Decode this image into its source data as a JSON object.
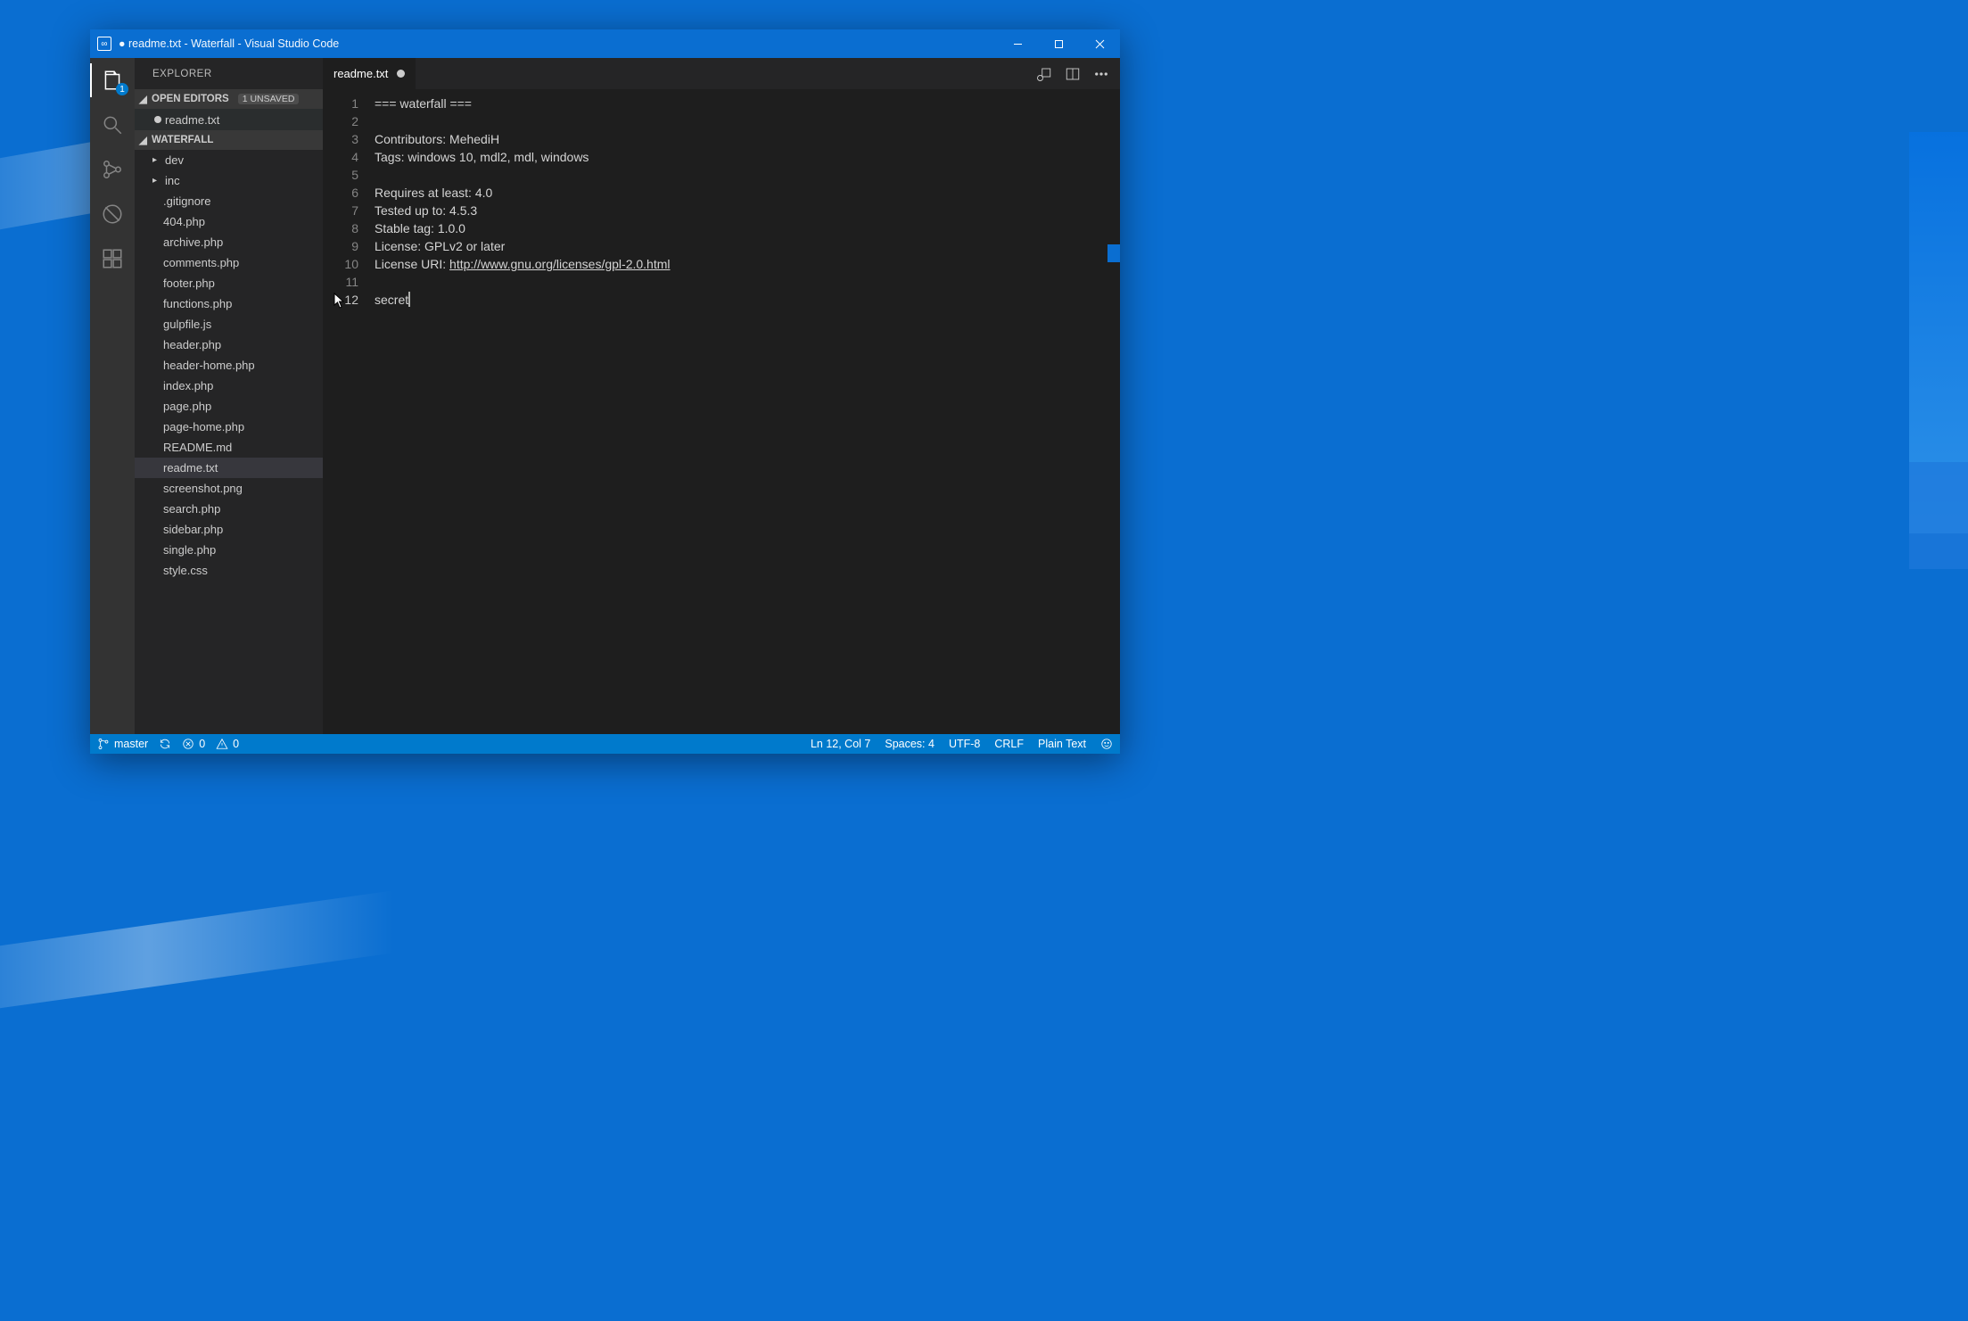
{
  "window": {
    "title": "● readme.txt - Waterfall - Visual Studio Code"
  },
  "activitybar": {
    "explorer_badge": "1"
  },
  "sidebar": {
    "title": "EXPLORER",
    "open_editors_label": "OPEN EDITORS",
    "unsaved_badge": "1 UNSAVED",
    "open_editor_item": "readme.txt",
    "project_label": "WATERFALL",
    "tree": [
      {
        "type": "folder",
        "name": "dev"
      },
      {
        "type": "folder",
        "name": "inc"
      },
      {
        "type": "file",
        "name": ".gitignore"
      },
      {
        "type": "file",
        "name": "404.php"
      },
      {
        "type": "file",
        "name": "archive.php"
      },
      {
        "type": "file",
        "name": "comments.php"
      },
      {
        "type": "file",
        "name": "footer.php"
      },
      {
        "type": "file",
        "name": "functions.php"
      },
      {
        "type": "file",
        "name": "gulpfile.js"
      },
      {
        "type": "file",
        "name": "header.php"
      },
      {
        "type": "file",
        "name": "header-home.php"
      },
      {
        "type": "file",
        "name": "index.php"
      },
      {
        "type": "file",
        "name": "page.php"
      },
      {
        "type": "file",
        "name": "page-home.php"
      },
      {
        "type": "file",
        "name": "README.md"
      },
      {
        "type": "file",
        "name": "readme.txt",
        "selected": true
      },
      {
        "type": "file",
        "name": "screenshot.png"
      },
      {
        "type": "file",
        "name": "search.php"
      },
      {
        "type": "file",
        "name": "sidebar.php"
      },
      {
        "type": "file",
        "name": "single.php"
      },
      {
        "type": "file",
        "name": "style.css"
      }
    ]
  },
  "tab": {
    "name": "readme.txt"
  },
  "editor": {
    "lines": [
      "=== waterfall ===",
      "",
      "Contributors: MehediH",
      "Tags: windows 10, mdl2, mdl, windows",
      "",
      "Requires at least: 4.0",
      "Tested up to: 4.5.3",
      "Stable tag: 1.0.0",
      "License: GPLv2 or later"
    ],
    "line10_prefix": "License URI: ",
    "line10_link": "http://www.gnu.org/licenses/gpl-2.0.html",
    "line11": "",
    "line12": "secret",
    "current_line": 12
  },
  "status": {
    "branch": "master",
    "errors": "0",
    "warnings": "0",
    "position": "Ln 12, Col 7",
    "spaces": "Spaces: 4",
    "encoding": "UTF-8",
    "eol": "CRLF",
    "lang": "Plain Text"
  }
}
